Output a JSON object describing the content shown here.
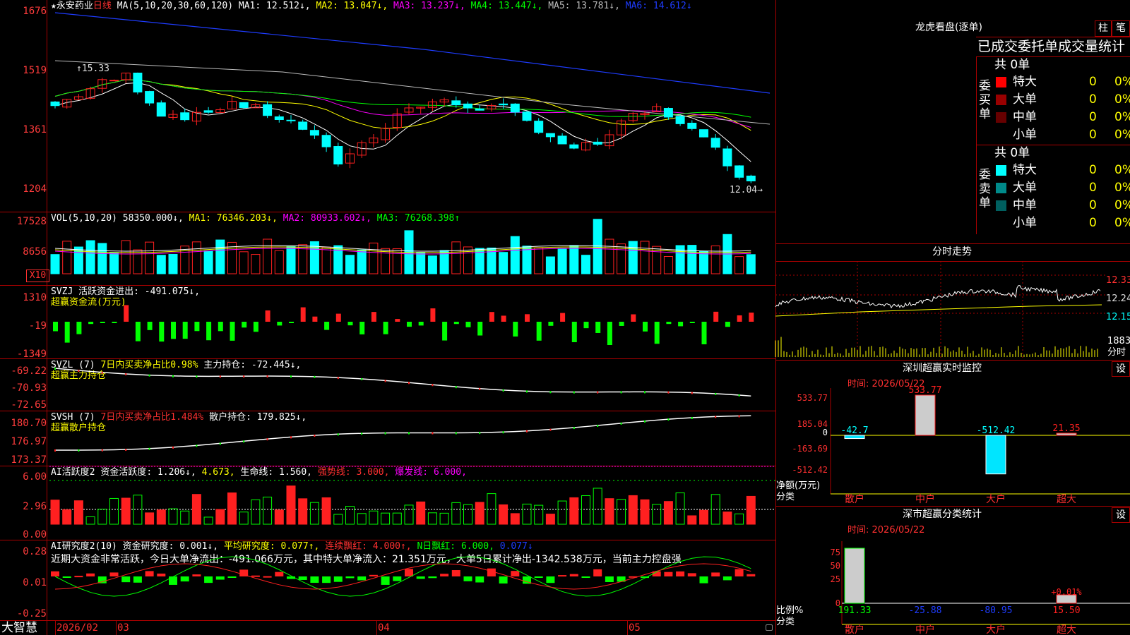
{
  "colors": {
    "up": "#ff2020",
    "down": "#00ffff",
    "bg": "#000000",
    "grid": "#a00000",
    "ma1": "#ffffff",
    "ma2": "#ffff00",
    "ma3": "#ff00ff",
    "ma4": "#00ff00",
    "ma5": "#bbbbbb",
    "ma6": "#1e3cff",
    "pos": "#ff2020",
    "neg": "#00ff00",
    "accent_yellow": "#ffff00"
  },
  "header": {
    "star": "★",
    "stock": "永安药业",
    "period": "日线",
    "ma_spec": "MA(5,10,20,30,60,120)",
    "ma1": "MA1: 12.512↓,",
    "ma2": "MA2: 13.047↓,",
    "ma3": "MA3: 13.237↓,",
    "ma4": "MA4: 13.447↓,",
    "ma5": "MA5: 13.781↓,",
    "ma6": "MA6: 14.612↓"
  },
  "price_axis": [
    "1676",
    "1519",
    "1361",
    "1204"
  ],
  "price_annot": {
    "high": "15.33",
    "low": "12.04→"
  },
  "vol": {
    "title": "VOL(5,10,20)",
    "value": "58350.000↓,",
    "ma1": "MA1: 76346.203↓,",
    "ma2": "MA2: 80933.602↓,",
    "ma3": "MA3: 76268.398↑",
    "axis": [
      "17528",
      "8656"
    ],
    "unit": "X10"
  },
  "svzj": {
    "title": "SVZJ  活跃资金进出: -491.075↓,",
    "sub": "超赢资金流(万元)",
    "axis": [
      "1310",
      "-19",
      "-1349"
    ]
  },
  "svzl": {
    "title": "SVZL (7)",
    "pct": "7日内买卖净占比0.98%",
    "value": "主力持仓: -72.445↓,",
    "sub": "超赢主力持仓",
    "axis": [
      "-69.22",
      "-70.93",
      "-72.65"
    ]
  },
  "svsh": {
    "title": "SVSH (7)",
    "pct": "7日内买卖净占比1.484%",
    "value": "散户持仓: 179.825↓,",
    "sub": "超赢散户持仓",
    "axis": [
      "180.70",
      "176.97",
      "173.37"
    ]
  },
  "ai1": {
    "title": "AI活跃度2",
    "v1": "资金活跃度: 1.206↓,",
    "v2": "4.673,",
    "v3": "生命线: 1.560,",
    "v4": "强势线: 3.000,",
    "v5": "爆发线: 6.000,",
    "axis": [
      "6.00",
      "2.96",
      "0.00"
    ]
  },
  "ai2": {
    "title": "AI研究度2(10)",
    "v1": "资金研究度: 0.001↓,",
    "v2": "平均研究度: 0.077↑,",
    "v3": "连续飘红: 4.000↑,",
    "v4": "N日飘红: 6.000,",
    "v5": "0.077↓",
    "comment": "近期大资金非常活跃，今日大单净流出：-491.066万元，其中特大单净流入：21.351万元，大单5日累计净出-1342.538万元，当前主力控盘强",
    "axis": [
      "0.28",
      "0.01",
      "-0.25"
    ]
  },
  "footer": {
    "brand": "大智慧",
    "dates": [
      "2026/02",
      "03",
      "04",
      "05"
    ]
  },
  "right": {
    "title": "龙虎看盘(逐单)",
    "tab1": "柱",
    "tab2": "笔",
    "table_title": "已成交委托单成交量统计",
    "buy": {
      "label": "委买单",
      "total": "共 0单",
      "rows": [
        {
          "name": "特大",
          "val": "0",
          "pct": "0%",
          "color": "#ff0000"
        },
        {
          "name": "大单",
          "val": "0",
          "pct": "0%",
          "color": "#990000"
        },
        {
          "name": "中单",
          "val": "0",
          "pct": "0%",
          "color": "#660000"
        },
        {
          "name": "小单",
          "val": "0",
          "pct": "0%",
          "color": "#000000"
        }
      ]
    },
    "sell": {
      "label": "委卖单",
      "total": "共 0单",
      "rows": [
        {
          "name": "特大",
          "val": "0",
          "pct": "0%",
          "color": "#00ffff"
        },
        {
          "name": "大单",
          "val": "0",
          "pct": "0%",
          "color": "#008a8a"
        },
        {
          "name": "中单",
          "val": "0",
          "pct": "0%",
          "color": "#006060"
        },
        {
          "name": "小单",
          "val": "0",
          "pct": "0%",
          "color": "#000000"
        }
      ]
    },
    "intraday": {
      "title": "分时走势",
      "axis": [
        "12.33",
        "12.24",
        "12.15"
      ],
      "vol_label": "1883",
      "vol_unit": "分时"
    },
    "monitor": {
      "title": "深圳超赢实时监控",
      "settings": "设",
      "time": "时间: 2026/05/22",
      "axis": [
        "533.77",
        "185.04",
        "0",
        "-163.69",
        "-512.42"
      ],
      "ylabel": "净额(万元)",
      "xlabel": "分类",
      "categories": [
        "散户",
        "中户",
        "大户",
        "超大"
      ],
      "values": [
        -42.7,
        533.77,
        -512.42,
        21.35
      ],
      "value_labels": [
        "-42.7",
        "533.77",
        "-512.42",
        "21.35"
      ]
    },
    "classify": {
      "title": "深市超赢分类统计",
      "settings": "设",
      "time": "时间: 2026/05/22",
      "axis": [
        "75",
        "50",
        "25",
        "0"
      ],
      "ylabel": "比例%",
      "xlabel": "分类",
      "categories": [
        "散户",
        "中户",
        "大户",
        "超大"
      ],
      "values": [
        191.33,
        -25.88,
        -80.95,
        15.5
      ],
      "value_labels": [
        "191.33",
        "-25.88",
        "-80.95",
        "15.50"
      ],
      "annot": "+0.01%"
    }
  }
}
